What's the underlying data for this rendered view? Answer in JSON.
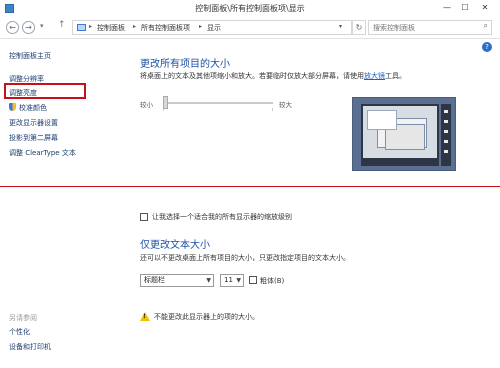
{
  "window": {
    "title": "控制面板\\所有控制面板项\\显示",
    "minimize": "—",
    "maximize": "☐",
    "close": "✕"
  },
  "address": {
    "back": "←",
    "forward": "→",
    "up": "↑",
    "segments": [
      "控制面板",
      "所有控制面板项",
      "显示"
    ],
    "search_placeholder": "搜索控制面板"
  },
  "sidebar": {
    "items": [
      {
        "label": "控制面板主页"
      },
      {
        "label": "调整分辨率"
      },
      {
        "label": "调整亮度"
      },
      {
        "label": "校准颜色"
      },
      {
        "label": "更改显示器设置"
      },
      {
        "label": "投影到第二屏幕"
      },
      {
        "label": "调整 ClearType 文本"
      }
    ],
    "see_also_label": "另请参阅",
    "see_also_items": [
      {
        "label": "个性化"
      },
      {
        "label": "设备和打印机"
      }
    ]
  },
  "main": {
    "size_section": {
      "title": "更改所有项目的大小",
      "description_prefix": "将桌面上的文本及其他项缩小和放大。若要临时仅放大部分屏幕，请使用",
      "description_link": "放大镜",
      "description_suffix": "工具。",
      "slider_min_label": "较小",
      "slider_max_label": "较大",
      "slider_value": 0
    },
    "scale_checkbox": {
      "label": "让我选择一个适合我的所有显示器的缩放级别",
      "checked": false
    },
    "text_section": {
      "title": "仅更改文本大小",
      "description": "还可以不更改桌面上所有项目的大小，只更改指定项目的文本大小。",
      "item_select": "标题栏",
      "size_select": "11",
      "bold_label": "粗体(B)",
      "bold_checked": false
    },
    "warning": "不能更改此显示器上的项的大小。"
  }
}
